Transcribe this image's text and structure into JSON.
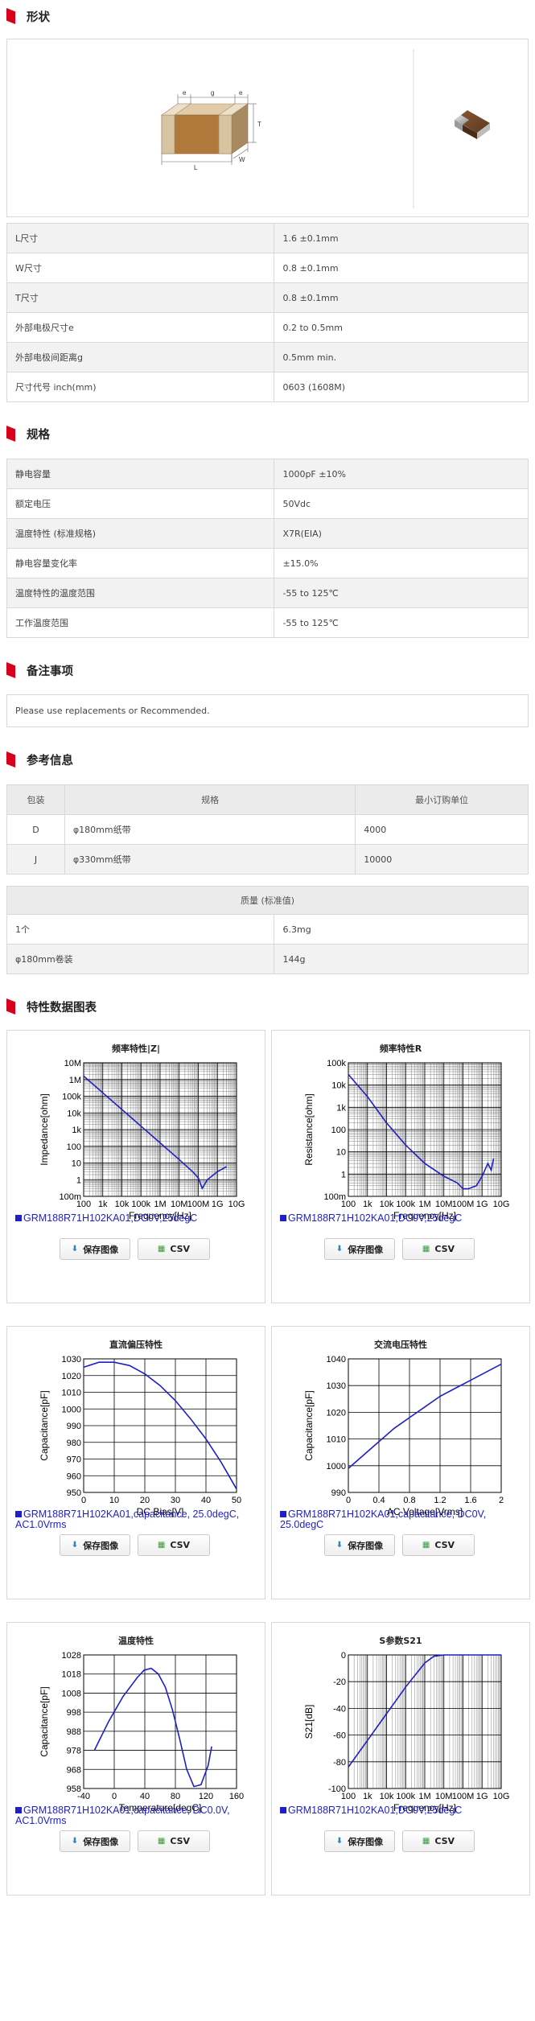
{
  "sections": {
    "shape": "形状",
    "spec": "规格",
    "notes": "备注事项",
    "reference": "参考信息",
    "charts": "特性数据图表"
  },
  "drawing_labels": {
    "e": "e",
    "g": "g",
    "t": "T",
    "l": "L",
    "w": "W"
  },
  "shape_rows": [
    {
      "label": "L尺寸",
      "value": "1.6 ±0.1mm"
    },
    {
      "label": "W尺寸",
      "value": "0.8 ±0.1mm"
    },
    {
      "label": "T尺寸",
      "value": "0.8 ±0.1mm"
    },
    {
      "label": "外部电极尺寸e",
      "value": "0.2 to 0.5mm"
    },
    {
      "label": "外部电极间距离g",
      "value": "0.5mm min."
    },
    {
      "label": "尺寸代号 inch(mm)",
      "value": "0603 (1608M)"
    }
  ],
  "spec_rows": [
    {
      "label": "静电容量",
      "value": "1000pF ±10%"
    },
    {
      "label": "额定电压",
      "value": "50Vdc"
    },
    {
      "label": "温度特性 (标准规格)",
      "value": "X7R(EIA)"
    },
    {
      "label": "静电容量变化率",
      "value": "±15.0%"
    },
    {
      "label": "温度特性的温度范围",
      "value": "-55 to 125℃"
    },
    {
      "label": "工作温度范围",
      "value": "-55 to 125℃"
    }
  ],
  "notes_text": "Please use replacements or Recommended.",
  "packaging": {
    "headers": [
      "包装",
      "规格",
      "最小订购单位"
    ],
    "rows": [
      [
        "D",
        "φ180mm纸带",
        "4000"
      ],
      [
        "J",
        "φ330mm纸带",
        "10000"
      ]
    ]
  },
  "mass": {
    "header": "质量 (标准值)",
    "rows": [
      {
        "label": "1个",
        "value": "6.3mg"
      },
      {
        "label": "φ180mm卷装",
        "value": "144g"
      }
    ]
  },
  "buttons": {
    "save": "保存图像",
    "csv": "CSV"
  },
  "series_color": "#1f1fc8",
  "chart_data": [
    {
      "type": "line",
      "title": "频率特性|Z|",
      "xlabel": "Frequency[Hz]",
      "ylabel": "Impedance[ohm]",
      "xscale": "log",
      "yscale": "log",
      "xlim": [
        100,
        10000000000
      ],
      "ylim": [
        0.1,
        10000000
      ],
      "xticks": [
        "100",
        "1k",
        "10k",
        "100k",
        "1M",
        "10M",
        "100M",
        "1G",
        "10G"
      ],
      "yticks": [
        "100m",
        "1",
        "10",
        "100",
        "1k",
        "10k",
        "100k",
        "1M",
        "10M"
      ],
      "legend": "GRM188R71H102KA01,DC0V,25degC",
      "series": [
        {
          "x": [
            100,
            1000,
            10000,
            100000,
            1000000,
            10000000,
            50000000,
            100000000,
            160000000,
            300000000,
            1000000000,
            3000000000
          ],
          "y": [
            1600000,
            160000,
            16000,
            1600,
            160,
            16,
            3,
            1.3,
            0.3,
            1,
            3,
            6
          ]
        }
      ]
    },
    {
      "type": "line",
      "title": "频率特性R",
      "xlabel": "Frequency[Hz]",
      "ylabel": "Resistance[ohm]",
      "xscale": "log",
      "yscale": "log",
      "xlim": [
        100,
        10000000000
      ],
      "ylim": [
        0.1,
        100000
      ],
      "xticks": [
        "100",
        "1k",
        "10k",
        "100k",
        "1M",
        "10M",
        "100M",
        "1G",
        "10G"
      ],
      "yticks": [
        "100m",
        "1",
        "10",
        "100",
        "1k",
        "10k",
        "100k"
      ],
      "legend": "GRM188R71H102KA01,DC0V,25degC",
      "series": [
        {
          "x": [
            100,
            1000,
            10000,
            100000,
            1000000,
            10000000,
            50000000,
            100000000,
            200000000,
            500000000,
            1000000000,
            2000000000,
            3000000000,
            4000000000
          ],
          "y": [
            30000,
            3000,
            200,
            20,
            3,
            0.8,
            0.4,
            0.22,
            0.22,
            0.3,
            0.8,
            3,
            1.5,
            5
          ]
        }
      ]
    },
    {
      "type": "line",
      "title": "直流偏压特性",
      "xlabel": "DC Bias[V]",
      "ylabel": "Capacitance[pF]",
      "xlim": [
        0,
        50
      ],
      "ylim": [
        950,
        1030
      ],
      "xticks": [
        "0",
        "10",
        "20",
        "30",
        "40",
        "50"
      ],
      "yticks": [
        "950",
        "960",
        "970",
        "980",
        "990",
        "1000",
        "1010",
        "1020",
        "1030"
      ],
      "legend": "GRM188R71H102KA01,capacitance, 25.0degC, AC1.0Vrms",
      "series": [
        {
          "x": [
            0,
            5,
            10,
            15,
            20,
            25,
            30,
            35,
            40,
            45,
            50
          ],
          "y": [
            1025,
            1028,
            1028,
            1026,
            1021,
            1014,
            1005,
            994,
            982,
            968,
            952
          ]
        }
      ]
    },
    {
      "type": "line",
      "title": "交流电压特性",
      "xlabel": "AC Voltage[Vrms]",
      "ylabel": "Capacitance[pF]",
      "xlim": [
        0,
        2
      ],
      "ylim": [
        990,
        1040
      ],
      "xticks": [
        "0",
        "0.4",
        "0.8",
        "1.2",
        "1.6",
        "2"
      ],
      "yticks": [
        "990",
        "1000",
        "1010",
        "1020",
        "1030",
        "1040"
      ],
      "legend": "GRM188R71H102KA01,capacitance, DC0V, 25.0degC",
      "series": [
        {
          "x": [
            0,
            0.2,
            0.4,
            0.6,
            0.8,
            1.0,
            1.2,
            1.4,
            1.6,
            1.8,
            2.0
          ],
          "y": [
            999,
            1004,
            1009,
            1014,
            1018,
            1022,
            1026,
            1029,
            1032,
            1035,
            1038
          ]
        }
      ]
    },
    {
      "type": "line",
      "title": "温度特性",
      "xlabel": "Temperature[degC]",
      "ylabel": "Capacitance[pF]",
      "xlim": [
        -55,
        160
      ],
      "ylim": [
        958,
        1028
      ],
      "xticks": [
        "-40",
        "0",
        "40",
        "80",
        "120",
        "160"
      ],
      "yticks": [
        "958",
        "968",
        "978",
        "988",
        "998",
        "1008",
        "1018",
        "1028"
      ],
      "legend": "GRM188R71H102KA01,capacitance, DC0.0V, AC1.0Vrms",
      "series": [
        {
          "x": [
            -40,
            -20,
            0,
            20,
            30,
            40,
            50,
            60,
            70,
            80,
            90,
            100,
            110,
            120,
            125
          ],
          "y": [
            978,
            993,
            1006,
            1016,
            1020,
            1021,
            1018,
            1011,
            999,
            984,
            968,
            959,
            960,
            970,
            980
          ]
        }
      ]
    },
    {
      "type": "line",
      "title": "S参数S21",
      "xlabel": "Frequency[Hz]",
      "ylabel": "S21[dB]",
      "xscale": "log",
      "xlim": [
        100,
        10000000000
      ],
      "ylim": [
        -100,
        0
      ],
      "xticks": [
        "100",
        "1k",
        "10k",
        "100k",
        "1M",
        "10M",
        "100M",
        "1G",
        "10G"
      ],
      "yticks": [
        "-100",
        "-80",
        "-60",
        "-40",
        "-20",
        "0"
      ],
      "legend": "GRM188R71H102KA01,DC0V,25degC",
      "series": [
        {
          "x": [
            100,
            1000,
            10000,
            100000,
            1000000,
            3000000,
            10000000,
            100000000,
            1000000000,
            10000000000
          ],
          "y": [
            -84,
            -64,
            -44,
            -24,
            -6,
            -1,
            0,
            0,
            0,
            0
          ]
        }
      ]
    }
  ]
}
